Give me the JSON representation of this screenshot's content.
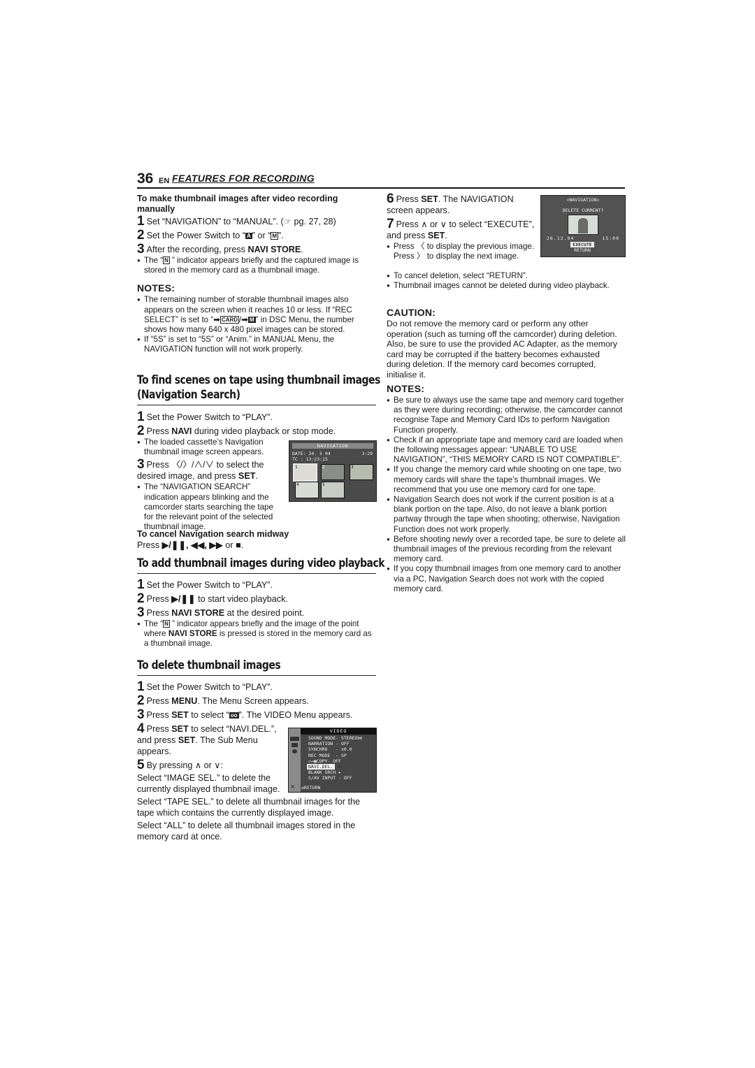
{
  "header": {
    "page_number": "36",
    "lang": "EN",
    "section": "FEATURES FOR RECORDING"
  },
  "manual_thumb": {
    "heading": "To make thumbnail images after video recording manually",
    "steps": [
      {
        "n": "1",
        "pre": "Set “NAVIGATION” to “MANUAL”. (",
        "ref_icon": "☞",
        "post": " pg. 27, 28)"
      },
      {
        "n": "2",
        "pre": "Set the Power Switch to “",
        "icon_a": "A",
        "mid": "” or “",
        "icon_m": "M",
        "post": "”."
      },
      {
        "n": "3",
        "pre": "After the recording, press ",
        "bold": "NAVI STORE",
        "post": "."
      }
    ],
    "bullet": {
      "pre": "The “",
      "icon": "N",
      "post": " ” indicator appears briefly and the captured image is stored in the memory card as a thumbnail image."
    }
  },
  "notes1": {
    "title": "NOTES:",
    "items": [
      {
        "pre": "The remaining number of storable thumbnail images also appears on the screen when it reaches 10 or less. If “REC SELECT” is set to “",
        "icon1": "➡",
        "icon2": "CARD",
        "sep": "/",
        "icon3": "➡",
        "icon4": "M",
        "post": "” in DSC Menu, the number shows how many 640 x 480 pixel images can be stored."
      },
      {
        "text": "If “5S” is set to “5S” or “Anim.” in MANUAL Menu, the NAVIGATION function will not work properly."
      }
    ]
  },
  "nav_search": {
    "heading_line1": "To find scenes on tape using thumbnail images",
    "heading_line2": "(Navigation Search)",
    "step1": {
      "n": "1",
      "text": "Set the Power Switch to “PLAY”."
    },
    "step2": {
      "n": "2",
      "pre": "Press ",
      "bold": "NAVI",
      "post": " during video playback or stop mode."
    },
    "bullet1": "The loaded cassette’s Navigation thumbnail image screen appears.",
    "step3": {
      "n": "3",
      "pre": "Press ",
      "arrows": "〈/〉/∧/∨",
      "mid": " to select the desired image, and press ",
      "bold": "SET",
      "post": "."
    },
    "bullet2": "The “NAVIGATION SEARCH” indication appears blinking and the camcorder starts searching the tape for the relevant point of the selected thumbnail image.",
    "cancel_heading": "To cancel Navigation search midway",
    "cancel_pre": "Press ",
    "cancel_buttons": "▶/❚❚, ◀◀, ▶▶",
    "cancel_mid": " or ",
    "cancel_stop": "■",
    "cancel_post": ".",
    "screen": {
      "title": "NAVIGATION",
      "date_label": "DATE: 24. 5 04",
      "time": "3:29",
      "tc_label": "TC  : 13:23:15",
      "thumbs": [
        "1",
        "2",
        "3",
        "4",
        "5"
      ],
      "selected_index": 0
    }
  },
  "add_thumb": {
    "heading": "To add thumbnail images during video playback",
    "step1": {
      "n": "1",
      "text": "Set the Power Switch to “PLAY”."
    },
    "step2": {
      "n": "2",
      "pre": "Press ",
      "bold": "▶/❚❚",
      "post": " to start video playback."
    },
    "step3": {
      "n": "3",
      "pre": "Press ",
      "bold": "NAVI STORE",
      "post": " at the desired point."
    },
    "bullet": {
      "pre": "The “",
      "icon": "N",
      "mid": " ” indicator appears briefly and the image of the point where ",
      "bold": "NAVI STORE",
      "post": " is pressed is stored in the memory card as a thumbnail image."
    }
  },
  "delete_thumb": {
    "heading": "To delete thumbnail images",
    "step1": {
      "n": "1",
      "text": "Set the Power Switch to “PLAY”."
    },
    "step2": {
      "n": "2",
      "pre": "Press ",
      "bold": "MENU",
      "post": ". The Menu Screen appears."
    },
    "step3": {
      "n": "3",
      "pre": "Press ",
      "bold": "SET",
      "mid": " to select “",
      "icon": "oo",
      "post": "”. The VIDEO Menu appears."
    },
    "step4": {
      "n": "4",
      "pre": "Press ",
      "bold": "SET",
      "mid": " to select “NAVI.DEL.”, and press ",
      "bold2": "SET",
      "post": ". The Sub Menu appears."
    },
    "step5": {
      "n": "5",
      "pre": "By pressing ",
      "arrows": "∧ or ∨",
      "post": ":"
    },
    "para1": "Select “IMAGE SEL.” to delete the currently displayed thumbnail image.",
    "para2": "Select “TAPE SEL.” to delete all thumbnail images for the tape which contains the currently displayed image.",
    "para3": "Select “ALL” to delete all thumbnail images stored in the memory card at once.",
    "menu": {
      "title": "VIDEO",
      "rows": [
        "SOUND MODE- STEREO⋈",
        "NARRATION - OFF",
        "SYNCHRO   - ±0.0",
        "REC MODE  - SP",
        "▭→▣COPY- OFF",
        "NAVI.DEL.  ▸",
        "BLANK SRCH ▸",
        "S/AV INPUT - OFF"
      ],
      "selected_index": 5,
      "footer": "↺RETURN",
      "close_icon": "✕"
    }
  },
  "right_col": {
    "step6": {
      "n": "6",
      "pre": "Press ",
      "bold": "SET",
      "post": ". The NAVIGATION screen appears."
    },
    "step7": {
      "n": "7",
      "pre": "Press ",
      "arrows": "∧ or ∨",
      "mid": " to select “EXECUTE”, and press ",
      "bold": "SET",
      "post": "."
    },
    "bullets": [
      {
        "pre": "Press ",
        "a1": "〈",
        "mid": " to display the previous image. Press ",
        "a2": "〉",
        "post": " to display the next image."
      },
      {
        "text": "To cancel deletion, select “RETURN”."
      },
      {
        "text": "Thumbnail images cannot be deleted during video playback."
      }
    ],
    "screen": {
      "title": "«NAVIGATION»",
      "prompt": "DELETE CURRENT?",
      "date": "26.12.04",
      "time": "15:00",
      "options": [
        "EXECUTE",
        "RETURN"
      ],
      "selected_index": 0
    },
    "caution": {
      "title": "CAUTION:",
      "text": "Do not remove the memory card or perform any other operation (such as turning off the camcorder) during deletion. Also, be sure to use the provided AC Adapter, as the memory card may be corrupted if the battery becomes exhausted during deletion. If the memory card becomes corrupted, initialise it."
    },
    "notes2": {
      "title": "NOTES:",
      "items": [
        "Be sure to always use the same tape and memory card together as they were during recording; otherwise, the camcorder cannot recognise Tape and Memory Card IDs to perform Navigation Function properly.",
        "Check if an appropriate tape and memory card are loaded when the following messages appear: “UNABLE TO USE NAVIGATION”, “THIS MEMORY CARD IS NOT COMPATIBLE”.",
        "If you change the memory card while shooting on one tape, two memory cards will share the tape’s thumbnail images. We recommend that you use one memory card for one tape.",
        "Navigation Search does not work if the current position is at a blank portion on the tape. Also, do not leave a blank portion partway through the tape when shooting; otherwise, Navigation Function does not work properly.",
        "Before shooting newly over a recorded tape, be sure to delete all thumbnail images of the previous recording from the relevant memory card.",
        "If you copy thumbnail images from one memory card to another via a PC, Navigation Search does not work with the copied memory card."
      ]
    }
  }
}
